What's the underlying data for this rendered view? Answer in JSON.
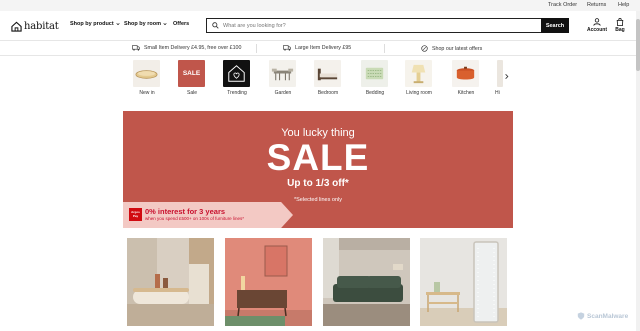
{
  "utility_links": {
    "track_order": "Track Order",
    "returns": "Returns",
    "help": "Help"
  },
  "brand": {
    "logo_text": "habitat",
    "logo_icon": "house-icon"
  },
  "nav": {
    "shop_by_product": "Shop by product",
    "shop_by_room": "Shop by room",
    "offers": "Offers"
  },
  "search": {
    "placeholder": "What are you looking for?",
    "value": "",
    "button": "Search"
  },
  "header_actions": {
    "account": "Account",
    "bag": "Bag"
  },
  "delivery": {
    "small": "Small Item Delivery £4.95, free over £100",
    "large": "Large Item Delivery £95",
    "offers": "Shop our latest offers"
  },
  "categories": [
    {
      "label": "New in",
      "icon": "rattan-tray-image"
    },
    {
      "label": "Sale",
      "tile_text": "SALE",
      "icon": "sale-tile"
    },
    {
      "label": "Trending",
      "icon": "heart-house-image"
    },
    {
      "label": "Garden",
      "icon": "garden-set-image"
    },
    {
      "label": "Bedroom",
      "icon": "bed-image"
    },
    {
      "label": "Bedding",
      "icon": "bedding-image"
    },
    {
      "label": "Living room",
      "icon": "lamp-image"
    },
    {
      "label": "Kitchen",
      "icon": "cookware-image"
    },
    {
      "label": "Hi",
      "icon": "partial-image"
    }
  ],
  "hero": {
    "line1": "You lucky thing",
    "headline": "SALE",
    "line3": "Up to 1/3 off*",
    "note": "*Selected lines only",
    "finance_badge_top": "Argos",
    "finance_badge_bottom": "Pay",
    "finance_title": "0% interest for 3 years",
    "finance_sub": "when you spend £500+ on 100s of furniture lines*"
  },
  "products": [
    {
      "name": "coffee-table-room"
    },
    {
      "name": "sideboard-pink-room"
    },
    {
      "name": "green-sofa-room"
    },
    {
      "name": "mirror-console-room"
    }
  ],
  "watermark": "ScanMalware",
  "colors": {
    "hero": "#c0564b",
    "finance_band": "#f3c9c4",
    "argos_red": "#d10a11",
    "search_btn": "#111111"
  }
}
